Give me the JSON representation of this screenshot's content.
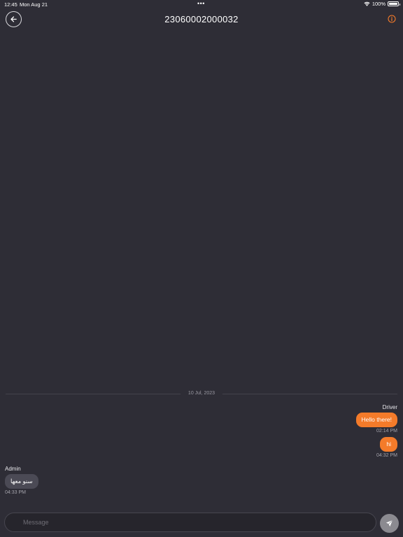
{
  "status_bar": {
    "time": "12:45",
    "date": "Mon Aug 21",
    "multitask_dots": "•••",
    "battery": "100%"
  },
  "header": {
    "title": "23060002000032",
    "back_icon": "arrow-left-icon",
    "info_icon": "info-circle-icon"
  },
  "conversation": {
    "date_separator": "10 Jul, 2023",
    "outgoing_sender": "Driver",
    "outgoing": [
      {
        "text": "Hello there!",
        "time": "02:14 PM"
      },
      {
        "text": "hi",
        "time": "04:32 PM"
      }
    ],
    "incoming_sender": "Admin",
    "incoming": [
      {
        "text": "سنو معها",
        "time": "04:33 PM"
      }
    ]
  },
  "composer": {
    "placeholder": "Message",
    "send_icon": "send-icon"
  },
  "colors": {
    "background": "#2e2d36",
    "accent": "#f47b2a",
    "incoming_bubble": "#4b4a55",
    "send_button": "#8b8a90"
  }
}
